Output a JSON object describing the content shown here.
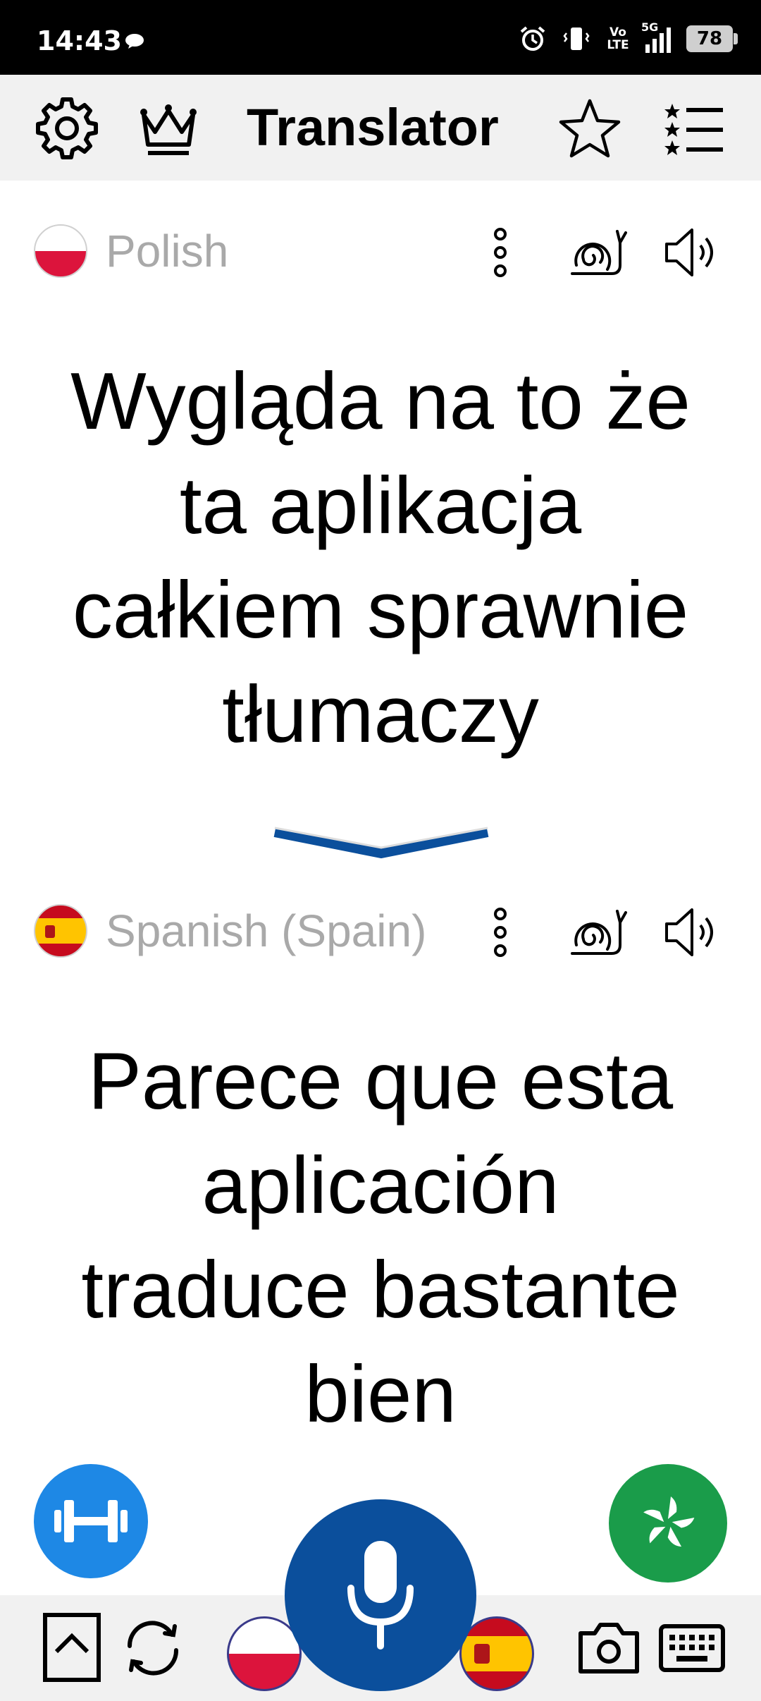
{
  "status_bar": {
    "time": "14:43",
    "network": "5G",
    "volte": "Vo LTE",
    "battery": "78"
  },
  "app_bar": {
    "title": "Translator",
    "icons": [
      "settings-gear-icon",
      "crown-premium-icon",
      "star-favorite-icon",
      "starred-list-icon"
    ]
  },
  "source": {
    "language": "Polish",
    "flag": "poland-flag",
    "text_lines": [
      "Wygląda na to że",
      "ta aplikacja",
      "całkiem sprawnie",
      "tłumaczy"
    ]
  },
  "target": {
    "language": "Spanish (Spain)",
    "flag": "spain-flag",
    "text_lines": [
      "Parece que esta",
      "aplicación",
      "traduce bastante",
      "bien"
    ]
  },
  "colors": {
    "accent_blue": "#0b4f9c",
    "fab_blue": "#1e88e5",
    "fab_green": "#1a9c4a",
    "label_gray": "#a9a9a9",
    "bar_gray": "#f1f1f1"
  },
  "bottom_bar": {
    "icons": [
      "expand-up-icon",
      "swap-languages-icon",
      "source-flag-poland",
      "microphone-icon",
      "target-flag-spain",
      "camera-icon",
      "keyboard-icon"
    ]
  }
}
